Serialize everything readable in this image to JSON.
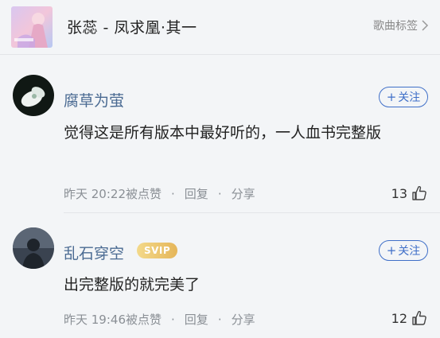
{
  "song": {
    "title": "张蕊 - 凤求凰·其一",
    "tags_label": "歌曲标签"
  },
  "comments": [
    {
      "username": "腐草为萤",
      "badge": "",
      "follow_label": "关注",
      "text": "觉得这是所有版本中最好听的，一人血书完整版",
      "time": "昨天 20:22",
      "upvote_label": "被点赞",
      "reply_label": "回复",
      "share_label": "分享",
      "likes": "13"
    },
    {
      "username": "乱石穿空",
      "badge": "SVIP",
      "follow_label": "关注",
      "text": "出完整版的就完美了",
      "time": "昨天 19:46",
      "upvote_label": "被点赞",
      "reply_label": "回复",
      "share_label": "分享",
      "likes": "12"
    }
  ],
  "colors": {
    "accent": "#3f6fc8",
    "username": "#4a6a92",
    "svip": "#e5b65a"
  }
}
